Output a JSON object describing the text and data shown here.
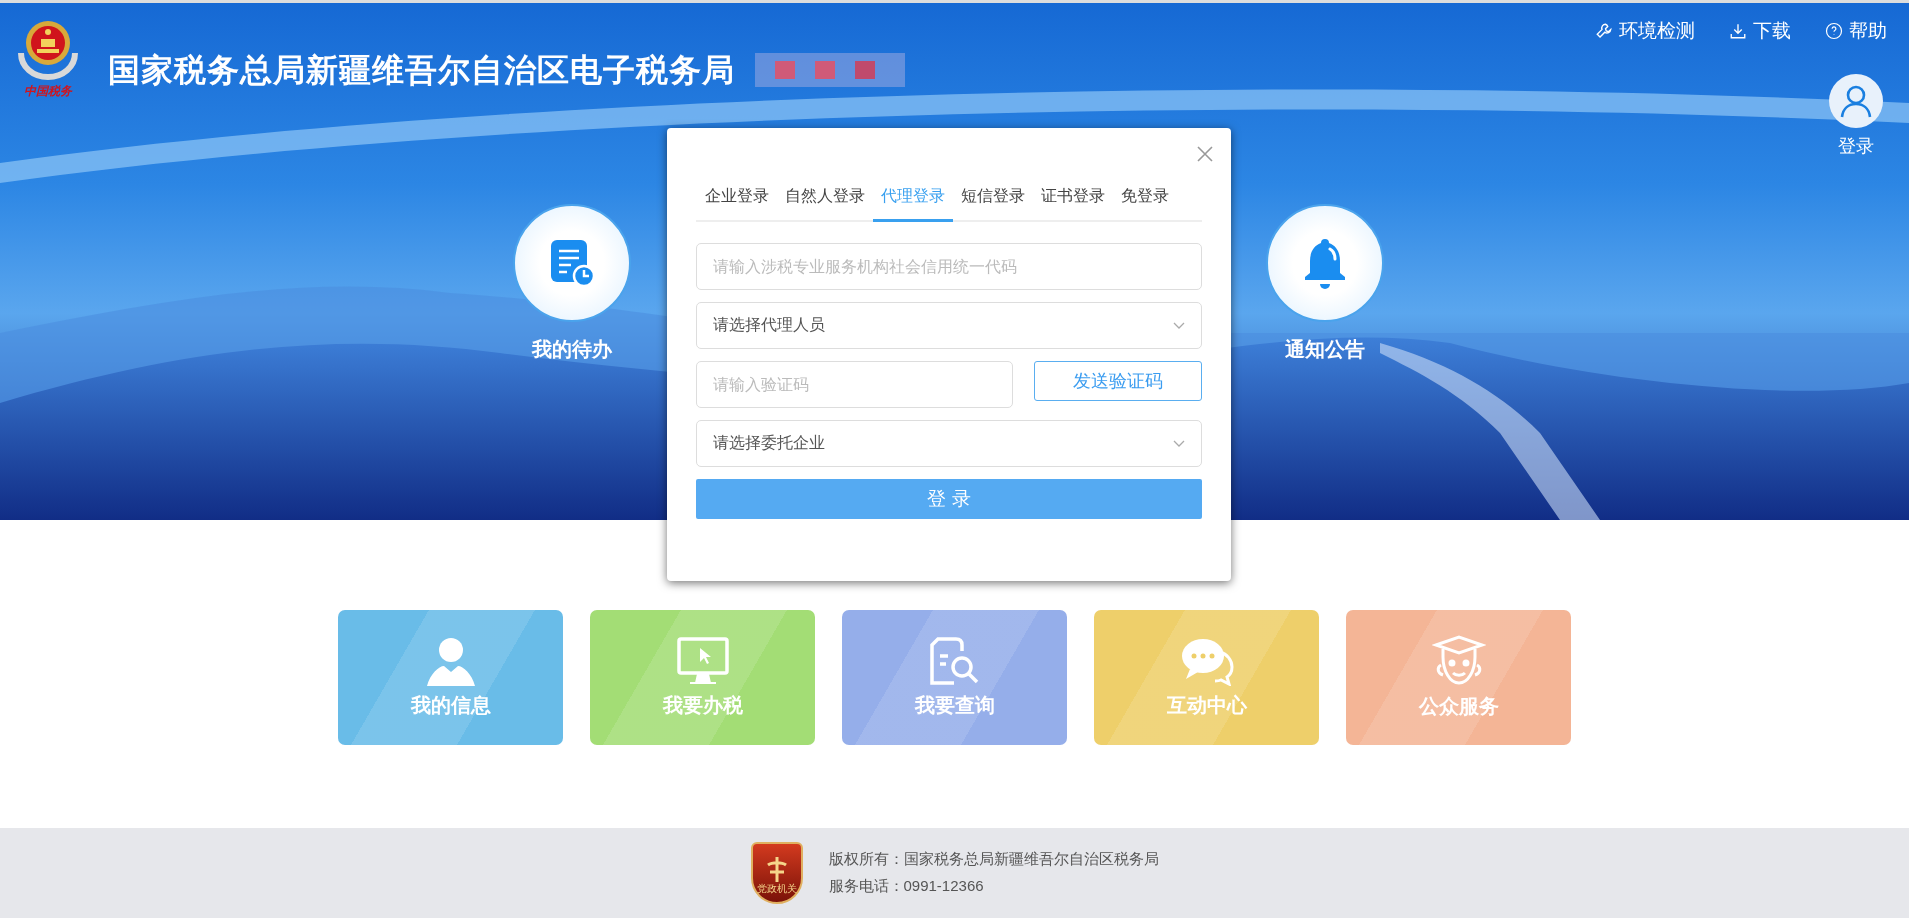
{
  "header": {
    "logo_text": "中国税务",
    "title": "国家税务总局新疆维吾尔自治区电子税务局",
    "links": [
      {
        "label": "环境检测"
      },
      {
        "label": "下载"
      },
      {
        "label": "帮助"
      }
    ],
    "user": {
      "label": "登录"
    }
  },
  "shortcuts": [
    {
      "label": "我的待办"
    },
    {
      "label": "通知公告"
    }
  ],
  "login_dialog": {
    "tabs": [
      {
        "label": "企业登录",
        "selected": false
      },
      {
        "label": "自然人登录",
        "selected": false
      },
      {
        "label": "代理登录",
        "selected": true
      },
      {
        "label": "短信登录",
        "selected": false
      },
      {
        "label": "证书登录",
        "selected": false
      },
      {
        "label": "免登录",
        "selected": false
      }
    ],
    "fields": [
      {
        "kind": "input",
        "placeholder": "请输入涉税专业服务机构社会信用统一代码"
      },
      {
        "kind": "select",
        "placeholder": "请选择代理人员"
      },
      {
        "kind": "code",
        "placeholder": "请输入验证码",
        "button": "发送验证码"
      },
      {
        "kind": "select",
        "placeholder": "请选择委托企业"
      }
    ],
    "submit": "登 录"
  },
  "tiles": [
    {
      "label": "我的信息",
      "color": "#69bce8"
    },
    {
      "label": "我要办税",
      "color": "#a3dd75"
    },
    {
      "label": "我要查询",
      "color": "#95aeea"
    },
    {
      "label": "互动中心",
      "color": "#eecf6a"
    },
    {
      "label": "公众服务",
      "color": "#f4b596"
    }
  ],
  "footer": {
    "badge_text": "党政机关",
    "copyright": "版权所有：国家税务总局新疆维吾尔自治区税务局",
    "phone": "服务电话：0991-12366"
  }
}
